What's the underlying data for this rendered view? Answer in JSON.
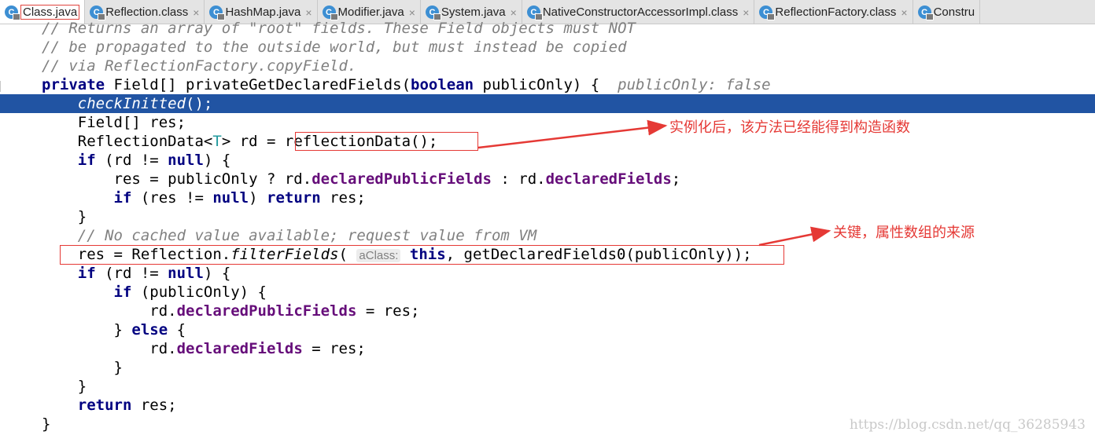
{
  "tabs": [
    {
      "label": "Class.java",
      "icon_letter": "C",
      "active": true
    },
    {
      "label": "Reflection.class",
      "icon_letter": "C",
      "active": false
    },
    {
      "label": "HashMap.java",
      "icon_letter": "C",
      "active": false
    },
    {
      "label": "Modifier.java",
      "icon_letter": "C",
      "active": false
    },
    {
      "label": "System.java",
      "icon_letter": "C",
      "active": false
    },
    {
      "label": "NativeConstructorAccessorImpl.class",
      "icon_letter": "C",
      "active": false
    },
    {
      "label": "ReflectionFactory.class",
      "icon_letter": "C",
      "active": false
    },
    {
      "label": "Constru",
      "icon_letter": "C",
      "active": false
    }
  ],
  "tab_close_glyph": "×",
  "code": {
    "l0": "// Returns an array of \"root\" fields. These Field objects must NOT",
    "l1": "// be propagated to the outside world, but must instead be copied",
    "l2": "// via ReflectionFactory.copyField.",
    "l3a": "private ",
    "l3b": "Field[] privateGetDeclaredFields(",
    "l3c": "boolean",
    "l3d": " publicOnly) {",
    "l3hint": "publicOnly: false",
    "l4a": "checkInitted",
    "l4b": "();",
    "l5": "Field[] res;",
    "l6a": "ReflectionData<",
    "l6b": "T",
    "l6c": "> rd = ",
    "l6d": "reflectionData();",
    "l7a": "if",
    "l7b": " (rd != ",
    "l7c": "null",
    "l7d": ") {",
    "l8a": "res = publicOnly ? rd.",
    "l8b": "declaredPublicFields",
    "l8c": " : rd.",
    "l8d": "declaredFields",
    "l8e": ";",
    "l9a": "if",
    "l9b": " (res != ",
    "l9c": "null",
    "l9d": ") ",
    "l9e": "return",
    "l9f": " res;",
    "l10": "}",
    "l11": "// No cached value available; request value from VM",
    "l12a": "res = Reflection.",
    "l12b": "filterFields",
    "l12c": "(",
    "l12chip": "aClass:",
    "l12d": "this",
    "l12e": ", getDeclaredFields0(publicOnly));",
    "l13a": "if",
    "l13b": " (rd != ",
    "l13c": "null",
    "l13d": ") {",
    "l14a": "if",
    "l14b": " (publicOnly) {",
    "l15a": "rd.",
    "l15b": "declaredPublicFields",
    "l15c": " = res;",
    "l16a": "} ",
    "l16b": "else",
    "l16c": " {",
    "l17a": "rd.",
    "l17b": "declaredFields",
    "l17c": " = res;",
    "l18": "}",
    "l19": "}",
    "l20a": "return",
    "l20b": " res;",
    "l21": "}"
  },
  "annotations": {
    "note1": "实例化后，该方法已经能得到构造函数",
    "note2": "关键，属性数组的来源",
    "color": "#e53935"
  },
  "watermark": "https://blog.csdn.net/qq_36285943",
  "colors": {
    "selection": "#2154a3",
    "keyword": "#000080",
    "field": "#660e7a",
    "comment": "#808080"
  }
}
